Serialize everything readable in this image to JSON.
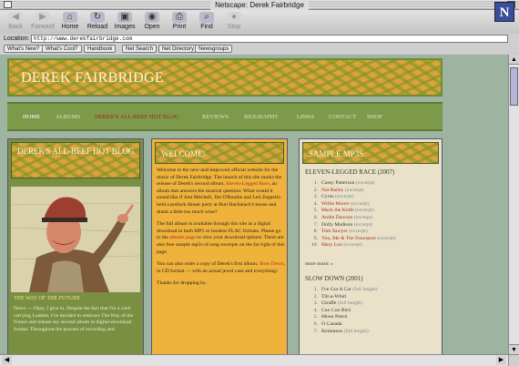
{
  "window": {
    "title": "Netscape: Derek Fairbridge"
  },
  "toolbar": {
    "buttons": [
      {
        "label": "Back",
        "icon": "back-arrow-icon",
        "glyph": "◀",
        "enabled": false
      },
      {
        "label": "Forward",
        "icon": "forward-arrow-icon",
        "glyph": "▶",
        "enabled": false
      },
      {
        "label": "Home",
        "icon": "home-icon",
        "glyph": "⌂",
        "enabled": true
      },
      {
        "label": "Reload",
        "icon": "reload-icon",
        "glyph": "↻",
        "enabled": true
      },
      {
        "label": "Images",
        "icon": "images-icon",
        "glyph": "▣",
        "enabled": true
      },
      {
        "label": "Open",
        "icon": "open-icon",
        "glyph": "◉",
        "enabled": true
      },
      {
        "label": "Print",
        "icon": "print-icon",
        "glyph": "⎙",
        "enabled": true
      },
      {
        "label": "Find",
        "icon": "find-icon",
        "glyph": "⌕",
        "enabled": true
      },
      {
        "label": "Stop",
        "icon": "stop-icon",
        "glyph": "●",
        "enabled": false
      }
    ],
    "logo_letter": "N"
  },
  "location": {
    "label": "Location:",
    "url": "http://www.derekfairbridge.com"
  },
  "directory_buttons": [
    "What's New?",
    "What's Cool?",
    "Handbook",
    "Net Search",
    "Net Directory",
    "Newsgroups"
  ],
  "site": {
    "title": "DEREK FAIRBRIDGE",
    "nav": [
      "HOME",
      "ALBUMS",
      "DEREK'S ALL-BEEF HOT BLOG",
      "REVIEWS",
      "BIOGRAPHY",
      "LINKS",
      "CONTACT",
      "SHOP"
    ],
    "blog": {
      "heading": "DEREK'S ALL-BEEF HOT BLOG",
      "post_title": "THE WAY OF THE FUTURE",
      "post_text": "News — Okay, I give in. Despite the fact that I'm a card-carrying Luddite, I've decided to embrace The Way of the Future and release my second album in digital-download format. Throughout the process of recording and"
    },
    "welcome": {
      "heading": "WELCOME!",
      "p1_a": "Welcome to the new-and-improved official website for the music of Derek Fairbridge. The launch of this site marks the release of Derek's second album, ",
      "p1_link": "Eleven-Legged Race",
      "p1_b": ", an album that answers the musical question: What would it sound like if Joni Mitchell, Jim O'Rourke and Led Zeppelin held a potluck dinner party at Burt Bacharach's house and drank a little too much wine?",
      "p2_a": "The full album is available through this site as a digital download in both MP3 or lossless FLAC formats. Please go to the ",
      "p2_link": "albums page",
      "p2_b": " to view your download options. There are also free sample mp3s of song excerpts on the far right of this page.",
      "p3_a": "You can also order a copy of Derek's first album, ",
      "p3_link": "Slow Down",
      "p3_b": ", in CD format — with an actual jewel case and everything!",
      "p4": "Thanks for dropping by."
    },
    "samples": {
      "heading": "SAMPLE MP3S",
      "album1": {
        "title": "ELEVEN-LEGGED RACE (2007)",
        "tracks": [
          {
            "n": "1.",
            "title": "Casey Patterson",
            "tag": "(excerpt)",
            "red": false
          },
          {
            "n": "2.",
            "title": "Nat Bailey",
            "tag": "(excerpt)",
            "red": true
          },
          {
            "n": "3.",
            "title": "Cyrus",
            "tag": "(excerpt)",
            "red": false
          },
          {
            "n": "4.",
            "title": "Willie Moore",
            "tag": "(excerpt)",
            "red": true
          },
          {
            "n": "5.",
            "title": "Mack the Knife",
            "tag": "(excerpt)",
            "red": true
          },
          {
            "n": "6.",
            "title": "Andre Dawson",
            "tag": "(excerpt)",
            "red": true
          },
          {
            "n": "7.",
            "title": "Dolly Madison",
            "tag": "(excerpt)",
            "red": false
          },
          {
            "n": "8.",
            "title": "Tom Sawyer",
            "tag": "(excerpt)",
            "red": true
          },
          {
            "n": "9.",
            "title": "You, Me & The Fenorpost",
            "tag": "(excerpt)",
            "red": true
          },
          {
            "n": "10.",
            "title": "Mary Lou",
            "tag": "(excerpt)",
            "red": true
          }
        ],
        "more": "more music »"
      },
      "album2": {
        "title": "SLOW DOWN (2001)",
        "tracks": [
          {
            "n": "1.",
            "title": "I've Got A Car",
            "tag": "(full length)"
          },
          {
            "n": "2.",
            "title": "Tilt-a-Whirl",
            "tag": ""
          },
          {
            "n": "3.",
            "title": "Giraffe",
            "tag": "(full length)"
          },
          {
            "n": "4.",
            "title": "Coo Coo Bird",
            "tag": ""
          },
          {
            "n": "5.",
            "title": "Moon Patrol",
            "tag": ""
          },
          {
            "n": "6.",
            "title": "O Canada",
            "tag": ""
          },
          {
            "n": "7.",
            "title": "Keremeos",
            "tag": "(full length)"
          }
        ]
      }
    }
  }
}
